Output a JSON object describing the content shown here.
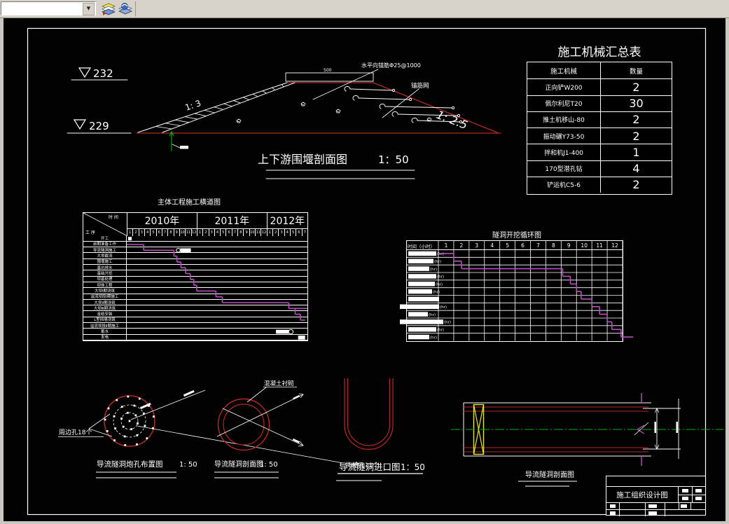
{
  "toolbar": {
    "combo_value": "",
    "dropdown_arrow": "▼",
    "icons": [
      "layers-icon",
      "layer-states-icon"
    ]
  },
  "cofferdam": {
    "elev_top": "232",
    "elev_bottom": "229",
    "slope_left": "1: 3",
    "slope_right": "1: 2.5",
    "crest_dim": "500",
    "anchor_note": "水平向锚筋Φ25@1000",
    "mesh_note": "锚筋网",
    "title": "上下游围堰剖面图",
    "scale": "1：50"
  },
  "machine_table": {
    "title": "施工机械汇总表",
    "headers": [
      "施工机械",
      "数量"
    ],
    "rows": [
      [
        "正向铲W200",
        "2"
      ],
      [
        "佩尔利尼T20",
        "30"
      ],
      [
        "推土机移山-80",
        "2"
      ],
      [
        "振动碾Y73-50",
        "2"
      ],
      [
        "拌和机J1-400",
        "1"
      ],
      [
        "170型潜孔钻",
        "4"
      ],
      [
        "铲运机C5-6",
        "2"
      ]
    ]
  },
  "gantt": {
    "title": "主体工程施工横道图",
    "corner_top": "时 间",
    "corner_bottom": "工 序",
    "years": [
      {
        "label": "2010年",
        "months": 12
      },
      {
        "label": "2011年",
        "months": 12
      },
      {
        "label": "2012年",
        "months": 7
      }
    ],
    "tasks": [
      "开工",
      "前期准备工作",
      "导流隧洞施工",
      "大坝截流",
      "围堰施工",
      "基坑排水",
      "基础开挖",
      "坝基处理",
      "坝体工程",
      "大坝Ⅰ期浇筑",
      "溢流坝段Ⅰ期施工",
      "大坝Ⅱ期浇筑",
      "大坝Ⅲ期浇筑",
      "金结安装",
      "L型挡墙浇筑",
      "溢流坝段Ⅱ期施工",
      "蓄水",
      "发电"
    ],
    "bars": [
      {
        "row": 2,
        "start": 0,
        "end": 2.9
      },
      {
        "row": 3,
        "start": 2.9,
        "end": 8.1
      },
      {
        "row": 4,
        "start": 8.1,
        "end": 8.6
      },
      {
        "row": 5,
        "start": 8.6,
        "end": 9.3
      },
      {
        "row": 6,
        "start": 9.3,
        "end": 10.1
      },
      {
        "row": 7,
        "start": 10.1,
        "end": 10.9
      },
      {
        "row": 8,
        "start": 10.9,
        "end": 11.5
      },
      {
        "row": 9,
        "start": 11.5,
        "end": 12.0
      },
      {
        "row": 10,
        "start": 12.0,
        "end": 15.3
      },
      {
        "row": 11,
        "start": 15.3,
        "end": 16.4
      },
      {
        "row": 12,
        "start": 16.4,
        "end": 27.8
      },
      {
        "row": 13,
        "start": 27.8,
        "end": 31
      },
      {
        "row": 14,
        "start": 28.9,
        "end": 29.8
      },
      {
        "row": 15,
        "start": 29.8,
        "end": 30.6
      }
    ],
    "milestone_row": 1,
    "annotations": [
      {
        "row": 3,
        "start": 9.2,
        "end": 11.0,
        "circle": "left"
      },
      {
        "row": 17,
        "start": 25.6,
        "end": 27.8,
        "circle": "right"
      },
      {
        "row": 18,
        "start": 29.4,
        "end": 30.6,
        "circle": "none"
      }
    ]
  },
  "cycle": {
    "title": "隧洞开挖循环图",
    "corner": "时间（小时）",
    "cols": [
      "1",
      "2",
      "3",
      "4",
      "5",
      "6",
      "7",
      "8",
      "9",
      "10",
      "11",
      "12"
    ],
    "row_label_suffix": "(hr)",
    "row_label_widths": [
      40,
      36,
      30,
      40,
      38,
      34,
      44,
      56,
      28,
      62,
      40,
      30
    ],
    "bars": [
      {
        "row": 1,
        "start": 0,
        "end": 1
      },
      {
        "row": 2,
        "start": 1,
        "end": 1.5
      },
      {
        "row": 3,
        "start": 1.5,
        "end": 8.1
      },
      {
        "row": 4,
        "start": 8.1,
        "end": 8.6
      },
      {
        "row": 5,
        "start": 8.6,
        "end": 9.0
      },
      {
        "row": 6,
        "start": 9.0,
        "end": 9.3
      },
      {
        "row": 7,
        "start": 9.3,
        "end": 10.0
      },
      {
        "row": 8,
        "start": 10.0,
        "end": 10.5
      },
      {
        "row": 9,
        "start": 10.5,
        "end": 11.0
      },
      {
        "row": 10,
        "start": 11.0,
        "end": 11.3
      },
      {
        "row": 11,
        "start": 11.3,
        "end": 11.9
      },
      {
        "row": 12,
        "start": 11.9,
        "end": 12.7
      }
    ]
  },
  "blast": {
    "label_left": "周边孔18个",
    "label_right": "掏槽孔11个",
    "title": "导流隧洞炮孔布置图",
    "scale": "1: 50"
  },
  "ring": {
    "label": "混凝土衬砌",
    "title": "导流隧洞剖面图",
    "scale": "1: 50"
  },
  "inlet": {
    "title": "导流隧洞进口图",
    "scale": "1：50"
  },
  "profile": {
    "title": "导流隧洞剖面图"
  },
  "titleblock": {
    "title": "施工组织设计图"
  },
  "colors": {
    "red": "#b42a26",
    "magenta": "#bb4cc1",
    "green": "#00b400",
    "yellow": "#e3e33a",
    "white": "#ffffff"
  }
}
